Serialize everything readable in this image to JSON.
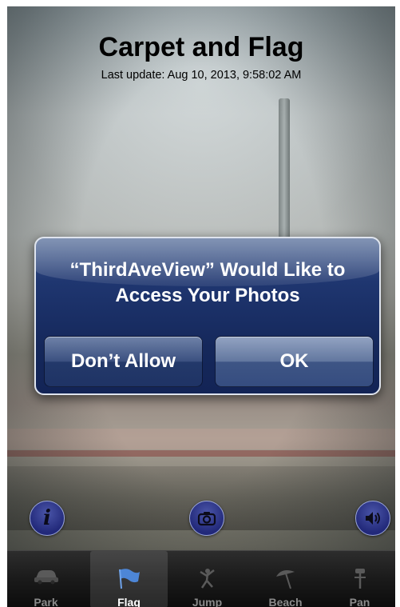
{
  "header": {
    "title": "Carpet and Flag",
    "last_update": "Last update: Aug 10, 2013, 9:58:02 AM"
  },
  "alert": {
    "title": "“ThirdAveView” Would Like to Access Your Photos",
    "cancel_label": "Don’t Allow",
    "ok_label": "OK"
  },
  "controls": {
    "info_icon": "info-icon",
    "info_glyph": "i",
    "camera_icon": "camera-icon",
    "sound_icon": "speaker-icon"
  },
  "tabbar": {
    "selected": "Flag",
    "tabs": [
      {
        "label": "Park",
        "icon": "car-icon"
      },
      {
        "label": "Flag",
        "icon": "flag-icon"
      },
      {
        "label": "Jump",
        "icon": "jumper-icon"
      },
      {
        "label": "Beach",
        "icon": "umbrella-icon"
      },
      {
        "label": "Pan",
        "icon": "pan-icon"
      }
    ]
  },
  "colors": {
    "alert_bg": "#1f3670",
    "tab_active": "#ffffff",
    "tab_inactive": "#8a8a8a",
    "round_button": "#2a3385"
  }
}
